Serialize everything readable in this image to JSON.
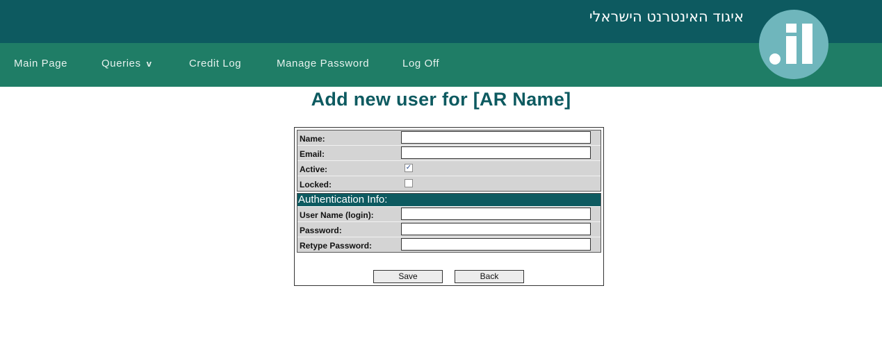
{
  "header": {
    "org_name": "איגוד האינטרנט הישראלי",
    "logo_text": ".il"
  },
  "nav": {
    "items": [
      {
        "label": "Main Page"
      },
      {
        "label": "Queries",
        "chevron": "v"
      },
      {
        "label": "Credit Log"
      },
      {
        "label": "Manage Password"
      },
      {
        "label": "Log Off"
      }
    ]
  },
  "page": {
    "title": "Add new user for [AR Name]"
  },
  "form": {
    "name_label": "Name:",
    "name_value": "",
    "email_label": "Email:",
    "email_value": "",
    "active_label": "Active:",
    "active_checked": true,
    "locked_label": "Locked:",
    "locked_checked": false,
    "auth_section": "Authentication Info:",
    "username_label": "User Name (login):",
    "username_value": "",
    "password_label": "Password:",
    "retype_label": "Retype Password:",
    "save_label": "Save",
    "back_label": "Back"
  },
  "colors": {
    "topbar": "#0d5a60",
    "navbar": "#1f7d66",
    "logo": "#6fb6bc",
    "title": "#0d5a60"
  }
}
